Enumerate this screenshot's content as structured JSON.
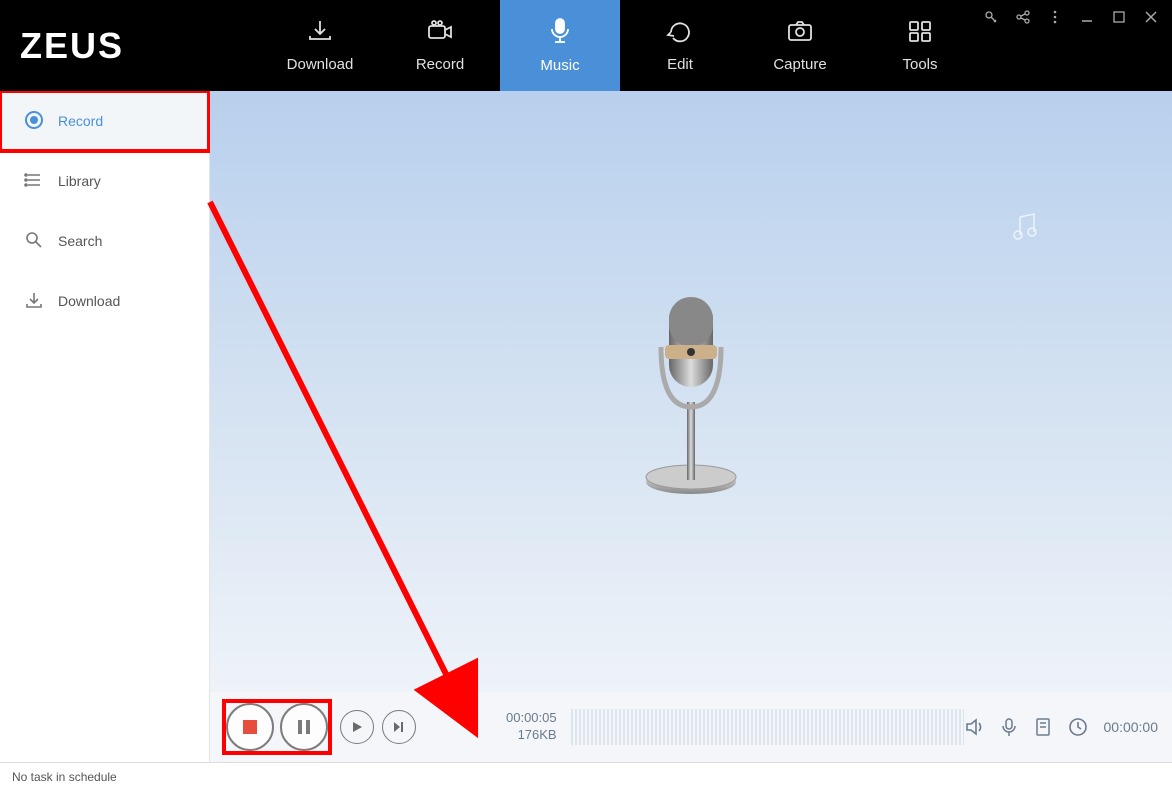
{
  "app": {
    "name": "ZEUS"
  },
  "nav": {
    "items": [
      {
        "label": "Download"
      },
      {
        "label": "Record"
      },
      {
        "label": "Music",
        "active": true
      },
      {
        "label": "Edit"
      },
      {
        "label": "Capture"
      },
      {
        "label": "Tools"
      }
    ]
  },
  "sidebar": {
    "items": [
      {
        "label": "Record",
        "icon": "record-dot-icon",
        "active": true,
        "highlighted": true
      },
      {
        "label": "Library",
        "icon": "list-icon"
      },
      {
        "label": "Search",
        "icon": "search-icon"
      },
      {
        "label": "Download",
        "icon": "download-icon"
      }
    ]
  },
  "recorder": {
    "elapsed": "00:00:05",
    "size": "176KB",
    "duration": "00:00:00"
  },
  "status": {
    "text": "No task in schedule"
  },
  "colors": {
    "accent": "#4a90d9",
    "highlight": "#ff0000"
  }
}
